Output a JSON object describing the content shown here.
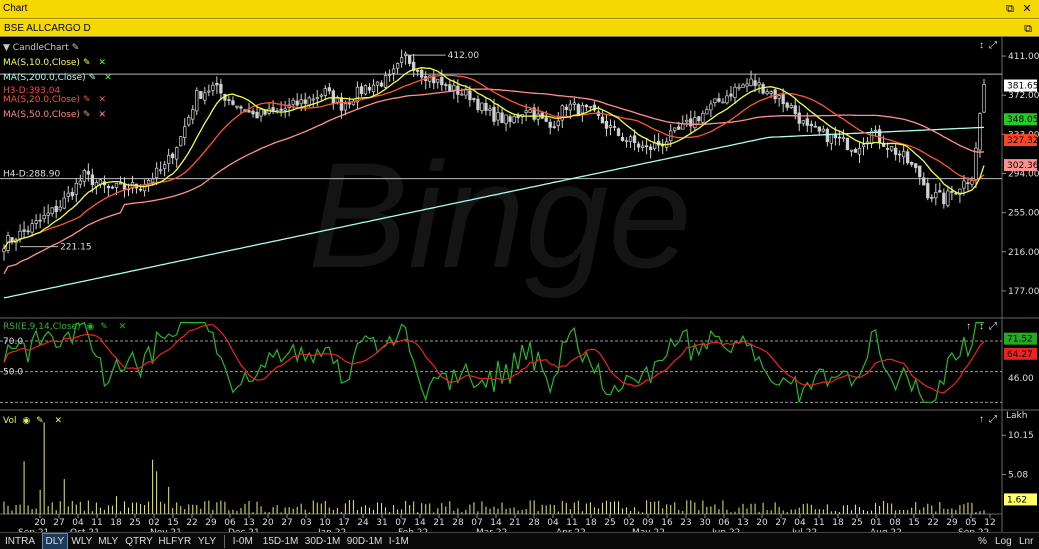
{
  "window": {
    "title": "Chart",
    "symbol_title": "BSE ALLCARGO D"
  },
  "price_panel": {
    "legend": [
      {
        "label": "CandleChart",
        "color": "#c8c8c8"
      },
      {
        "label": "MA(S,10.0,Close)",
        "color": "#ffff44"
      },
      {
        "label": "MA(S,200.0,Close)",
        "color": "#aaffee"
      },
      {
        "label": "H3-D:393.04",
        "color": "#ff4444"
      },
      {
        "label": "MA(S,20.0,Close)",
        "color": "#ff5533"
      },
      {
        "label": "MA(S,50.0,Close)",
        "color": "#ff8888"
      }
    ],
    "hline_label_h4": "H4-D:288.90",
    "annotation_high": "412.00",
    "annotation_low": "221.15",
    "axis_ticks": [
      "411.00",
      "372.00",
      "333.00",
      "294.00",
      "255.00",
      "216.00",
      "177.00"
    ],
    "value_tags": [
      {
        "text": "381.65",
        "bg": "#ffffff",
        "fg": "#000000"
      },
      {
        "text": "348.05",
        "bg": "#22cc22",
        "fg": "#000000"
      },
      {
        "text": "327.32",
        "bg": "#ff4422",
        "fg": "#000000"
      },
      {
        "text": "302.36",
        "bg": "#ff9090",
        "fg": "#000000"
      }
    ],
    "watermark": "Binge"
  },
  "rsi_panel": {
    "legend": "RSI(E,9,14,Close)",
    "level_high": "70.0",
    "level_low": "50.0",
    "axis_ticks": [
      "46.00"
    ],
    "value_tags": [
      {
        "text": "71.52",
        "bg": "#22aa22",
        "fg": "#000000"
      },
      {
        "text": "64.27",
        "bg": "#ee2222",
        "fg": "#000000"
      }
    ]
  },
  "vol_panel": {
    "legend": "Vol",
    "unit": "Lakh",
    "axis_ticks": [
      "10.15",
      "5.08"
    ],
    "value_tag": {
      "text": "1.62",
      "bg": "#ffff66",
      "fg": "#000000"
    }
  },
  "x_axis": {
    "labels": [
      "20",
      "27",
      "04",
      "11",
      "18",
      "25",
      "02",
      "15",
      "22",
      "29",
      "06",
      "13",
      "20",
      "27",
      "03",
      "10",
      "17",
      "24",
      "31",
      "07",
      "14",
      "21",
      "28",
      "07",
      "14",
      "21",
      "28",
      "04",
      "11",
      "18",
      "25",
      "02",
      "09",
      "16",
      "23",
      "30",
      "06",
      "13",
      "20",
      "27",
      "04",
      "11",
      "18",
      "25",
      "01",
      "08",
      "15",
      "22",
      "29",
      "05",
      "12"
    ],
    "months": [
      "Sep 21",
      "Oct 21",
      "Nov 21",
      "Dec 21",
      "Jan 22",
      "Feb 22",
      "Mar 22",
      "Apr 22",
      "May 22",
      "Jun 22",
      "Jul 22",
      "Aug 22",
      "Sep 22"
    ]
  },
  "bottom_bar": {
    "timeframes": [
      "INTRA",
      "DLY",
      "WLY",
      "MLY",
      "QTRY",
      "HLFYR",
      "YLY"
    ],
    "active": "DLY",
    "ranges": [
      "I-0M",
      "15D-1M",
      "30D-1M",
      "90D-1M",
      "I-1M"
    ],
    "scale_options": [
      "%",
      "Log",
      "Lnr"
    ]
  },
  "colors": {
    "grid": "#555555",
    "candle": "#d0d0d0",
    "ma10": "#eeff44",
    "ma20": "#ff5533",
    "ma50": "#ff9090",
    "ma200": "#aaffee",
    "rsi": "#22bb22",
    "rsi_signal": "#ee2222",
    "vol": "#eeee55"
  }
}
